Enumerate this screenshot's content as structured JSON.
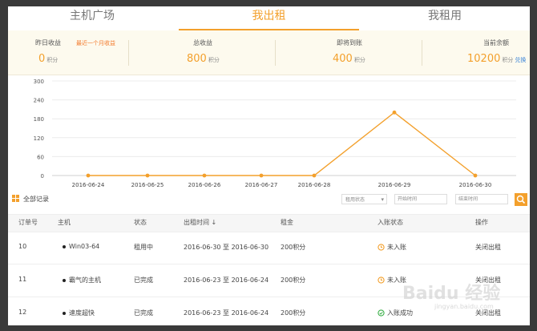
{
  "tabs": [
    {
      "label": "主机广场"
    },
    {
      "label": "我出租"
    },
    {
      "label": "我租用"
    }
  ],
  "stats": {
    "yesterday": {
      "label": "昨日收益",
      "value": "0",
      "unit": "积分",
      "note": "最近一个月收益"
    },
    "total": {
      "label": "总收益",
      "value": "800",
      "unit": "积分"
    },
    "pending": {
      "label": "即将到账",
      "value": "400",
      "unit": "积分"
    },
    "balance": {
      "label": "当前余额",
      "value": "10200",
      "unit": "积分",
      "link": "兑换"
    }
  },
  "chart_data": {
    "type": "line",
    "categories": [
      "2016-06-24",
      "2016-06-25",
      "2016-06-26",
      "2016-06-27",
      "2016-06-28",
      "2016-06-29",
      "2016-06-30"
    ],
    "values": [
      0,
      0,
      0,
      0,
      0,
      200,
      0
    ],
    "yticks": [
      0,
      60,
      120,
      180,
      240,
      300
    ],
    "ylim": [
      0,
      300
    ],
    "color": "#f3a02c",
    "grid": true
  },
  "toolbar": {
    "label": "全部记录",
    "status_select": "租用状态",
    "start_placeholder": "开始时间",
    "end_placeholder": "结束时间"
  },
  "table": {
    "headers": [
      "订单号",
      "主机",
      "状态",
      "出租时间 ↓",
      "租金",
      "入账状态",
      "操作"
    ],
    "rows": [
      {
        "id": "10",
        "host": "Win03-64",
        "status": "租用中",
        "period": "2016-06-30 至 2016-06-30",
        "rent": "200积分",
        "entry": "未入账",
        "entry_state": "pending",
        "action": "关闭出租"
      },
      {
        "id": "11",
        "host": "霸气的主机",
        "status": "已完成",
        "period": "2016-06-23 至 2016-06-24",
        "rent": "200积分",
        "entry": "未入账",
        "entry_state": "pending",
        "action": "关闭出租"
      },
      {
        "id": "12",
        "host": "速度超快",
        "status": "已完成",
        "period": "2016-06-23 至 2016-06-24",
        "rent": "200积分",
        "entry": "入账成功",
        "entry_state": "done",
        "action": "关闭出租"
      }
    ]
  },
  "watermark": {
    "text": "Baidu 经验",
    "sub": "jingyan.baidu.com"
  }
}
